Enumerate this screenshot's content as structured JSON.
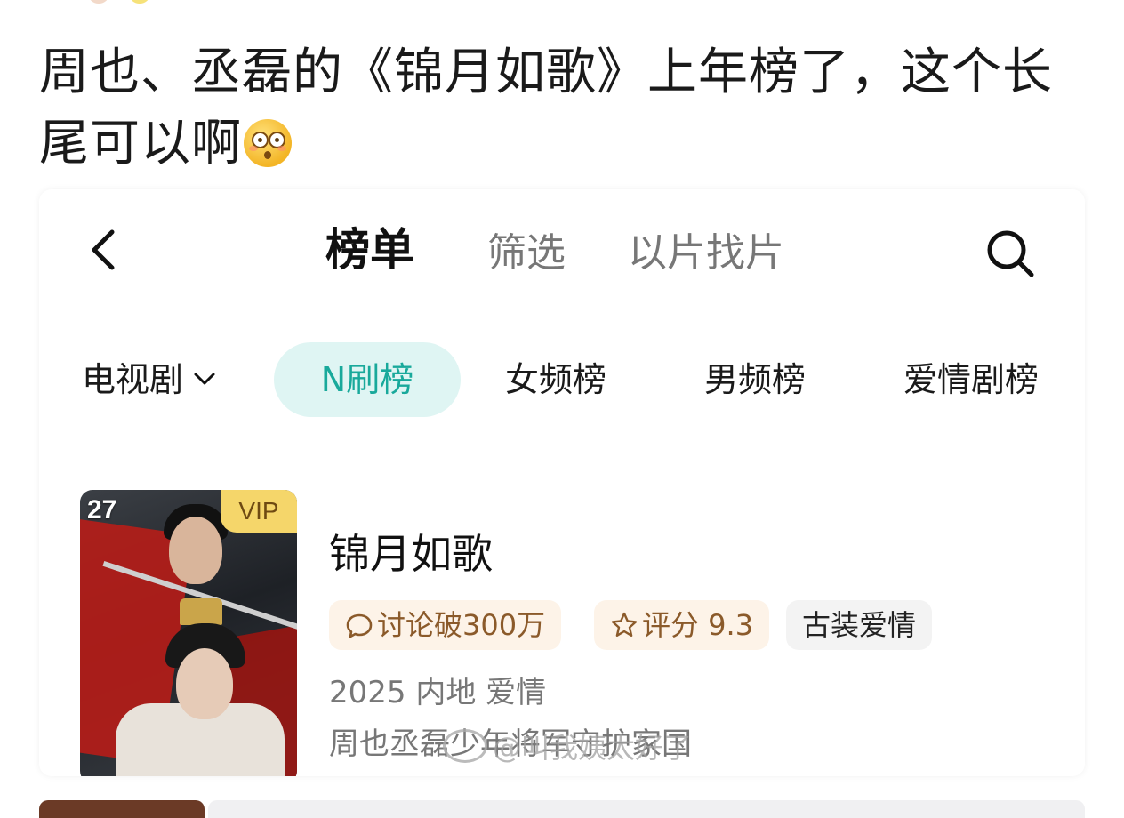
{
  "post": {
    "text": "周也、丞磊的《锦月如歌》上年榜了，这个长尾可以啊",
    "emoji": "flushed-face-emoji"
  },
  "app": {
    "tabs": [
      {
        "label": "榜单",
        "active": true
      },
      {
        "label": "筛选",
        "active": false
      },
      {
        "label": "以片找片",
        "active": false
      }
    ],
    "categories": [
      {
        "label": "电视剧",
        "dropdown": true,
        "active": false
      },
      {
        "label": "N刷榜",
        "active": true
      },
      {
        "label": "女频榜",
        "active": false
      },
      {
        "label": "男频榜",
        "active": false
      },
      {
        "label": "爱情剧榜",
        "active": false
      }
    ],
    "item": {
      "rank": "27",
      "badge": "VIP",
      "title": "锦月如歌",
      "discuss_tag": "讨论破300万",
      "score_tag": "评分 9.3",
      "genre_tag": "古装爱情",
      "meta": "2025 内地 爱情",
      "description": "周也丞磊少年将军守护家国"
    }
  },
  "watermark": "@叫我姨太好了",
  "colors": {
    "accent": "#19a99b",
    "accent_bg": "#dff5f3",
    "vip": "#f5d66a",
    "tag_warm_bg": "#fdf3e8"
  }
}
